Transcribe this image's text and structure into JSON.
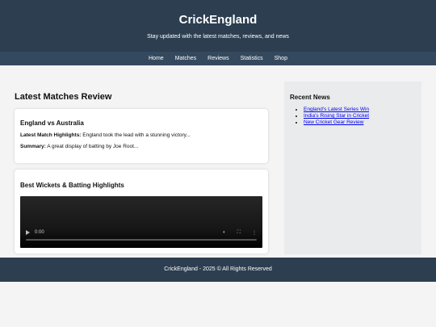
{
  "header": {
    "title": "CrickEngland",
    "tagline": "Stay updated with the latest matches, reviews, and news"
  },
  "nav": [
    "Home",
    "Matches",
    "Reviews",
    "Statistics",
    "Shop"
  ],
  "main": {
    "section_title": "Latest Matches Review",
    "match_card": {
      "title": "England vs Australia",
      "highlights_label": "Latest Match Highlights:",
      "highlights_text": " England took the lead with a stunning victory...",
      "summary_label": "Summary:",
      "summary_text": " A great display of batting by Joe Root..."
    },
    "video_card": {
      "title": "Best Wickets & Batting Highlights",
      "time": "0:00",
      "progress": 0
    }
  },
  "sidebar": {
    "title": "Recent News",
    "items": [
      "England's Latest Series Win",
      "India's Rising Star in Cricket",
      "New Cricket Gear Review"
    ]
  },
  "footer": {
    "text": "CrickEngland - 2025 © All Rights Reserved"
  },
  "colors": {
    "header_bg": "#2c3e50",
    "nav_bg": "#34495e",
    "sidebar_bg": "#e9ebec",
    "page_bg": "#f4f4f4"
  }
}
